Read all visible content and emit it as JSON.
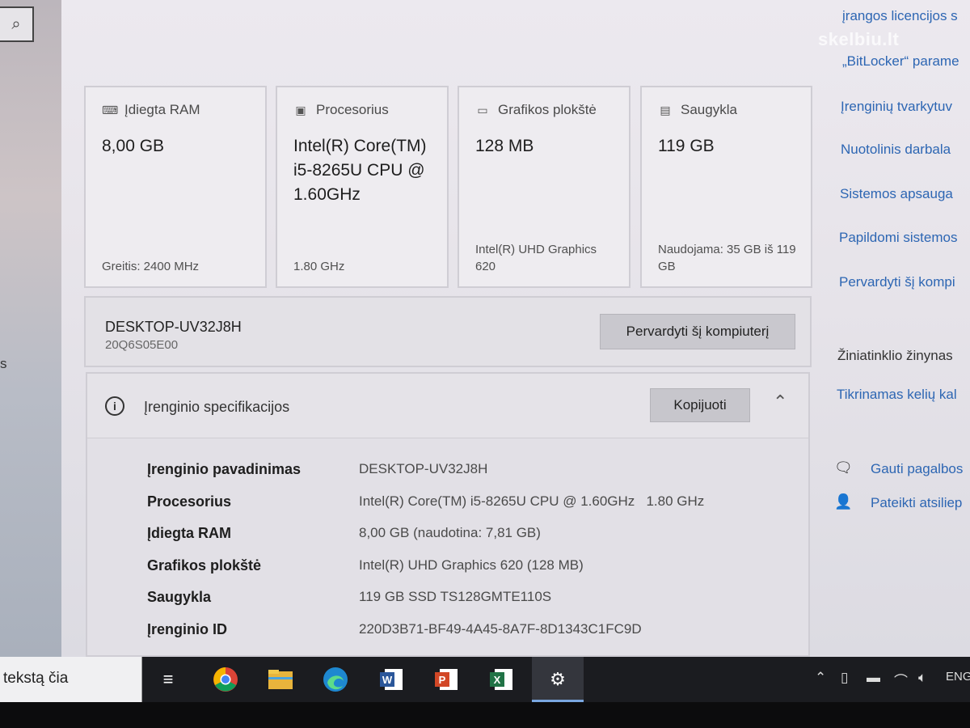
{
  "search_icon": "search-icon",
  "left_edge_text": "s",
  "cards": [
    {
      "icon": "ram-icon",
      "title": "Įdiegta RAM",
      "value": "8,00 GB",
      "footer": "Greitis: 2400 MHz"
    },
    {
      "icon": "cpu-icon",
      "title": "Procesorius",
      "value": "Intel(R) Core(TM) i5-8265U CPU @ 1.60GHz",
      "footer": "1.80 GHz"
    },
    {
      "icon": "gpu-icon",
      "title": "Grafikos plokštė",
      "value": "128 MB",
      "footer": "Intel(R) UHD Graphics 620"
    },
    {
      "icon": "storage-icon",
      "title": "Saugykla",
      "value": "119 GB",
      "footer": "Naudojama: 35 GB iš 119 GB"
    }
  ],
  "device": {
    "name": "DESKTOP-UV32J8H",
    "model": "20Q6S05E00",
    "rename_button": "Pervardyti šį kompiuterį"
  },
  "specs": {
    "title": "Įrenginio specifikacijos",
    "copy_button": "Kopijuoti",
    "rows": [
      {
        "label": "Įrenginio pavadinimas",
        "value": "DESKTOP-UV32J8H"
      },
      {
        "label": "Procesorius",
        "value": "Intel(R) Core(TM) i5-8265U CPU @ 1.60GHz   1.80 GHz"
      },
      {
        "label": "Įdiegta RAM",
        "value": "8,00 GB (naudotina: 7,81 GB)"
      },
      {
        "label": "Grafikos plokštė",
        "value": "Intel(R) UHD Graphics 620 (128 MB)"
      },
      {
        "label": "Saugykla",
        "value": "119 GB SSD TS128GMTE110S"
      },
      {
        "label": "Įrenginio ID",
        "value": "220D3B71-BF49-4A45-8A7F-8D1343C1FC9D"
      }
    ]
  },
  "right_panel": {
    "link_licenses": "įrangos licencijos s",
    "link_bitlocker": "„BitLocker“ parame",
    "link_device_manager": "Įrenginių tvarkytuv",
    "link_remote": "Nuotolinis darbala",
    "link_protection": "Sistemos apsauga",
    "link_advanced": "Papildomi sistemos",
    "link_rename": "Pervardyti šį kompi",
    "web_help_heading": "Žiniatinklio žinynas",
    "link_check_path": "Tikrinamas kelių kal",
    "link_get_help": "Gauti pagalbos",
    "link_feedback": "Pateikti atsiliep"
  },
  "watermark": "skelbiu.lt",
  "taskbar": {
    "search_placeholder": "tekstą čia",
    "apps": [
      "task-view",
      "chrome",
      "file-explorer",
      "edge",
      "word",
      "powerpoint",
      "excel",
      "settings"
    ],
    "language": "ENG"
  }
}
